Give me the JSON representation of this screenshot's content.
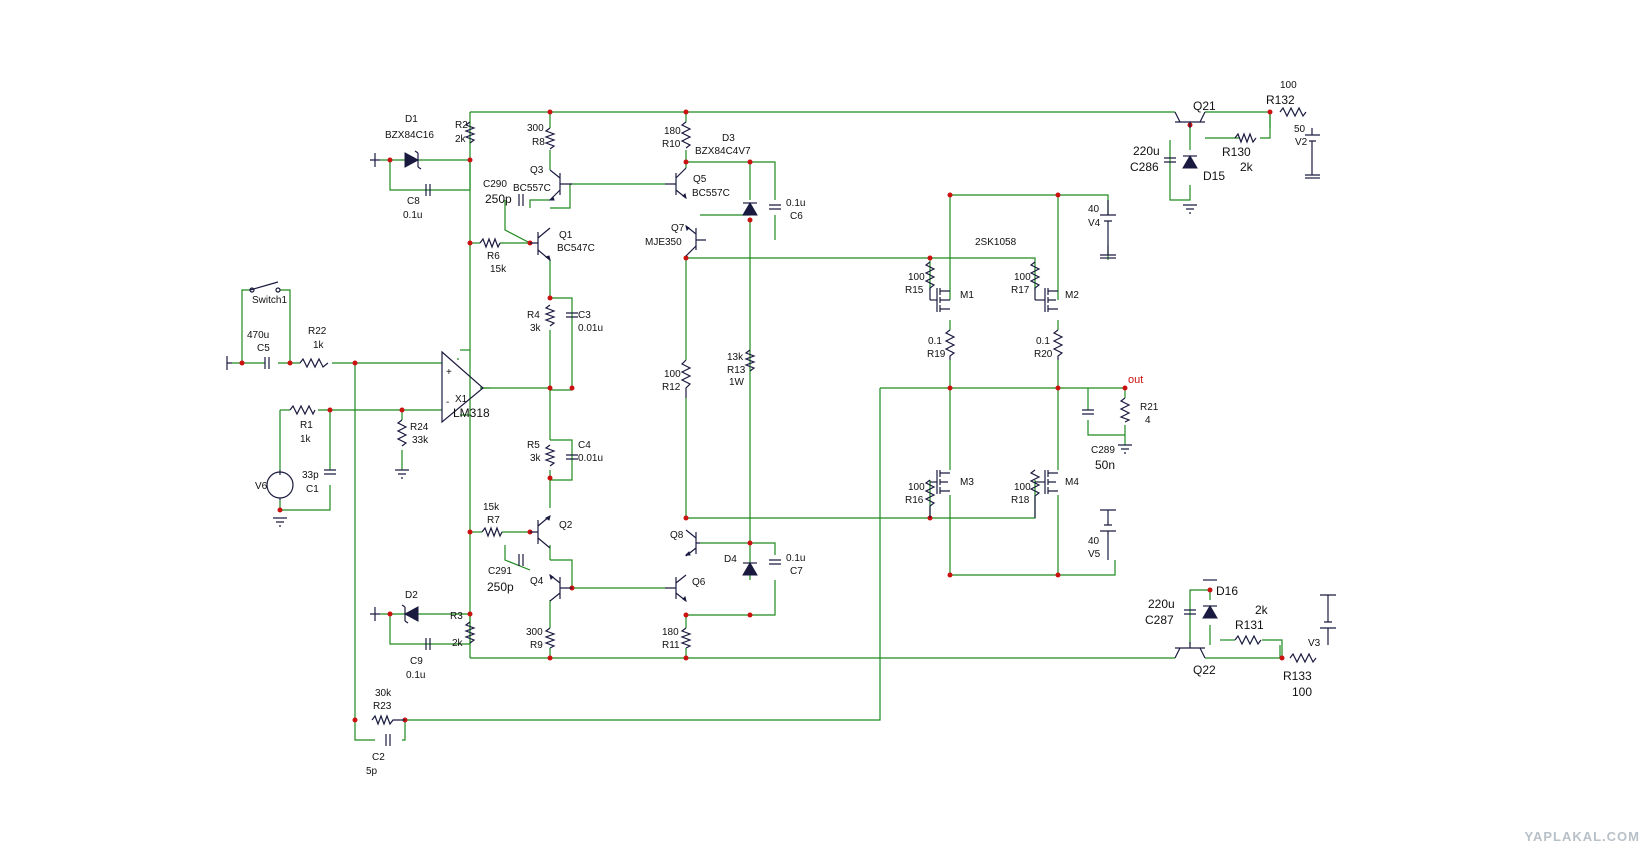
{
  "labels": {
    "d1": "D1",
    "d1_val": "BZX84C16",
    "r2": "R2",
    "r2_val": "2k",
    "c8": "C8",
    "c8_val": "0.1u",
    "r8_val": "300",
    "r8": "R8",
    "q3": "Q3",
    "q3_val": "BC557C",
    "c290": "C290",
    "c290_val": "250p",
    "q1": "Q1",
    "q1_val": "BC547C",
    "r6": "R6",
    "r6_val": "15k",
    "r10_val": "180",
    "r10": "R10",
    "d3": "D3",
    "d3_val": "BZX84C4V7",
    "q5": "Q5",
    "q5_val": "BC557C",
    "c6_val": "0.1u",
    "c6": "C6",
    "q7": "Q7",
    "q7_val": "MJE350",
    "q21": "Q21",
    "r132_val": "100",
    "r132": "R132",
    "v2_val": "50",
    "v2": "V2",
    "c286_val": "220u",
    "c286": "C286",
    "r130": "R130",
    "r130_val": "2k",
    "d15": "D15",
    "v4_val": "40",
    "v4": "V4",
    "mosfet_model": "2SK1058",
    "r15_val": "100",
    "r15": "R15",
    "m1": "M1",
    "r17_val": "100",
    "r17": "R17",
    "m2": "M2",
    "r19_val": "0.1",
    "r19": "R19",
    "r20_val": "0.1",
    "r20": "R20",
    "out": "out",
    "r21": "R21",
    "r21_val": "4",
    "c289": "C289",
    "c289_val": "50n",
    "switch1": "Switch1",
    "c5_val": "470u",
    "c5": "C5",
    "r22": "R22",
    "r22_val": "1k",
    "x1": "X1",
    "x1_val": "LM318",
    "r1": "R1",
    "r1_val": "1k",
    "r24": "R24",
    "r24_val": "33k",
    "v6": "V6",
    "c1_val": "33p",
    "c1": "C1",
    "r4": "R4",
    "r4_val": "3k",
    "c3": "C3",
    "c3_val": "0.01u",
    "r5": "R5",
    "r5_val": "3k",
    "c4": "C4",
    "c4_val": "0.01u",
    "r13_val": "13k",
    "r13": "R13",
    "r13_p": "1W",
    "r12_val": "100",
    "r12": "R12",
    "r16_val": "100",
    "r16": "R16",
    "m3": "M3",
    "r18_val": "100",
    "r18": "R18",
    "m4": "M4",
    "v5_val": "40",
    "v5": "V5",
    "r7_val": "15k",
    "r7": "R7",
    "q2": "Q2",
    "c291": "C291",
    "c291_val": "250p",
    "q4": "Q4",
    "q8": "Q8",
    "d4": "D4",
    "c7_val": "0.1u",
    "c7": "C7",
    "q6": "Q6",
    "d2": "D2",
    "r3": "R3",
    "r3_val": "2k",
    "c9": "C9",
    "c9_val": "0.1u",
    "r9_val": "300",
    "r9": "R9",
    "r11_val": "180",
    "r11": "R11",
    "d16": "D16",
    "c287_val": "220u",
    "c287": "C287",
    "r131_val": "2k",
    "r131": "R131",
    "v3": "V3",
    "q22": "Q22",
    "r133": "R133",
    "r133_val": "100",
    "r23_val": "30k",
    "r23": "R23",
    "c2": "C2",
    "c2_val": "5p",
    "plus": "+",
    "minus": "-"
  },
  "watermark": "YAPLAKAL.COM"
}
